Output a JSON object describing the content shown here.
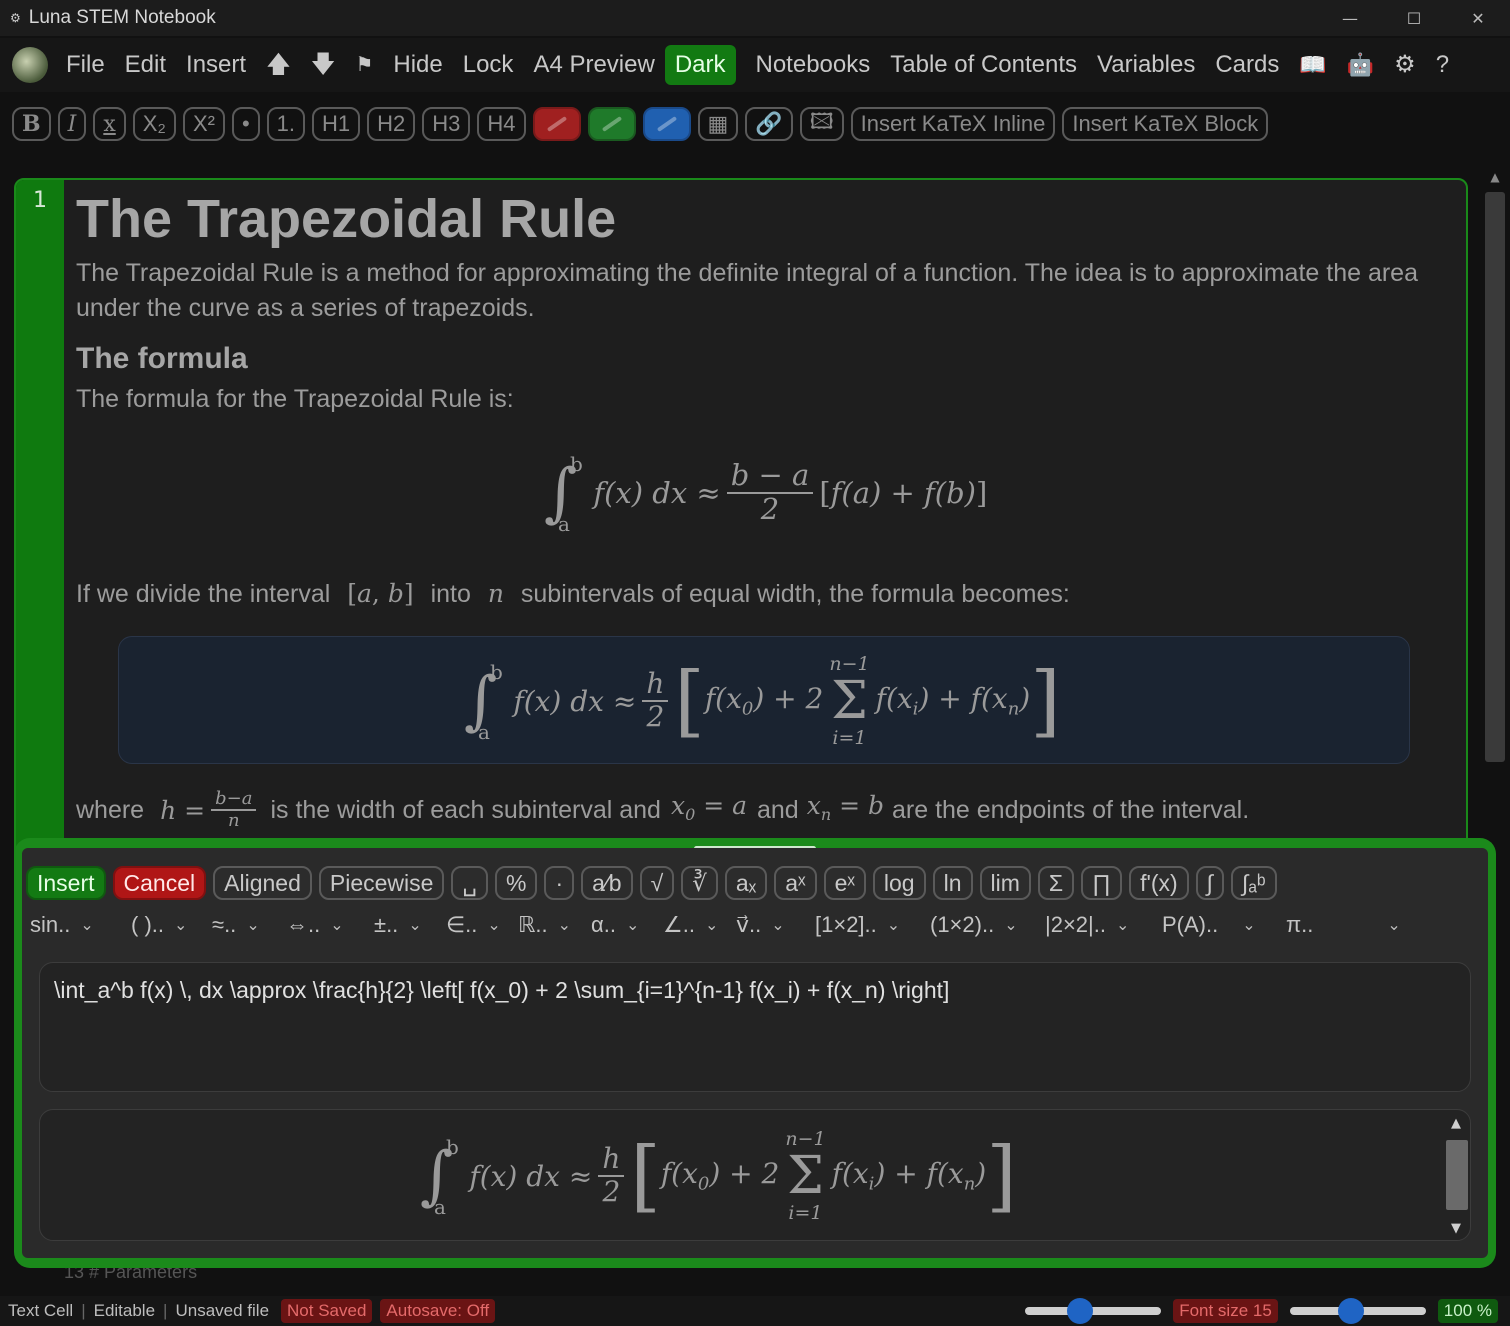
{
  "window": {
    "title": "Luna STEM Notebook",
    "icon": "gear-icon"
  },
  "menubar": {
    "items": [
      "File",
      "Edit",
      "Insert"
    ],
    "up_icon": "arrow-up-icon",
    "down_icon": "arrow-down-icon",
    "flag_icon": "flag-icon",
    "items2": [
      "Hide",
      "Lock",
      "A4 Preview"
    ],
    "dark": "Dark",
    "items3": [
      "Notebooks",
      "Table of Contents",
      "Variables",
      "Cards"
    ],
    "help": "?"
  },
  "toolbar": {
    "buttons": [
      "B",
      "I",
      "x",
      "X₂",
      "X²",
      "•",
      "1.",
      "H1",
      "H2",
      "H3",
      "H4"
    ],
    "katex_inline": "Insert KaTeX Inline",
    "katex_block": "Insert KaTeX Block"
  },
  "cell": {
    "line_number": "1",
    "title": "The Trapezoidal Rule",
    "intro": "The Trapezoidal Rule is a method for approximating the definite integral of a function. The idea is to approximate the area under the curve as a series of trapezoids.",
    "subtitle": "The formula",
    "formula_intro": "The formula for the Trapezoidal Rule is:",
    "divide_text_1": "If we divide the interval",
    "divide_text_2": "into",
    "divide_text_3": "subintervals of equal width, the formula becomes:",
    "where_1": "where",
    "where_2": "is the width of each subinterval and",
    "where_3": "and",
    "where_4": "are the endpoints of the interval."
  },
  "dialog": {
    "insert": "Insert",
    "cancel": "Cancel",
    "buttons": [
      "Aligned",
      "Piecewise",
      "␣",
      "%",
      "·",
      "a⁄b",
      "√",
      "∛",
      "aₓ",
      "aˣ",
      "eˣ",
      "log",
      "ln",
      "lim",
      "Σ",
      "∏",
      "f'(x)",
      "∫",
      "∫ₐᵇ"
    ],
    "dropdowns": [
      "sin..",
      "( )..",
      "≈..",
      "⇔..",
      "±..",
      "∈..",
      "ℝ..",
      "α..",
      "∠..",
      "v⃗..",
      "[1×2]..",
      "(1×2)..",
      "|2×2|..",
      "P(A)..",
      "π.."
    ],
    "source": "\\int_a^b f(x) \\, dx \\approx \\frac{h}{2} \\left[ f(x_0) + 2 \\sum_{i=1}^{n-1} f(x_i) + f(x_n) \\right]"
  },
  "status": {
    "cell_type": "Text Cell",
    "mode": "Editable",
    "file": "Unsaved file",
    "saved": "Not Saved",
    "autosave": "Autosave: Off",
    "font": "Font size 15",
    "zoom": "100 %",
    "font_slider_value": 0.38,
    "zoom_slider_value": 0.44
  },
  "behind_text": "13   #  Parameters"
}
